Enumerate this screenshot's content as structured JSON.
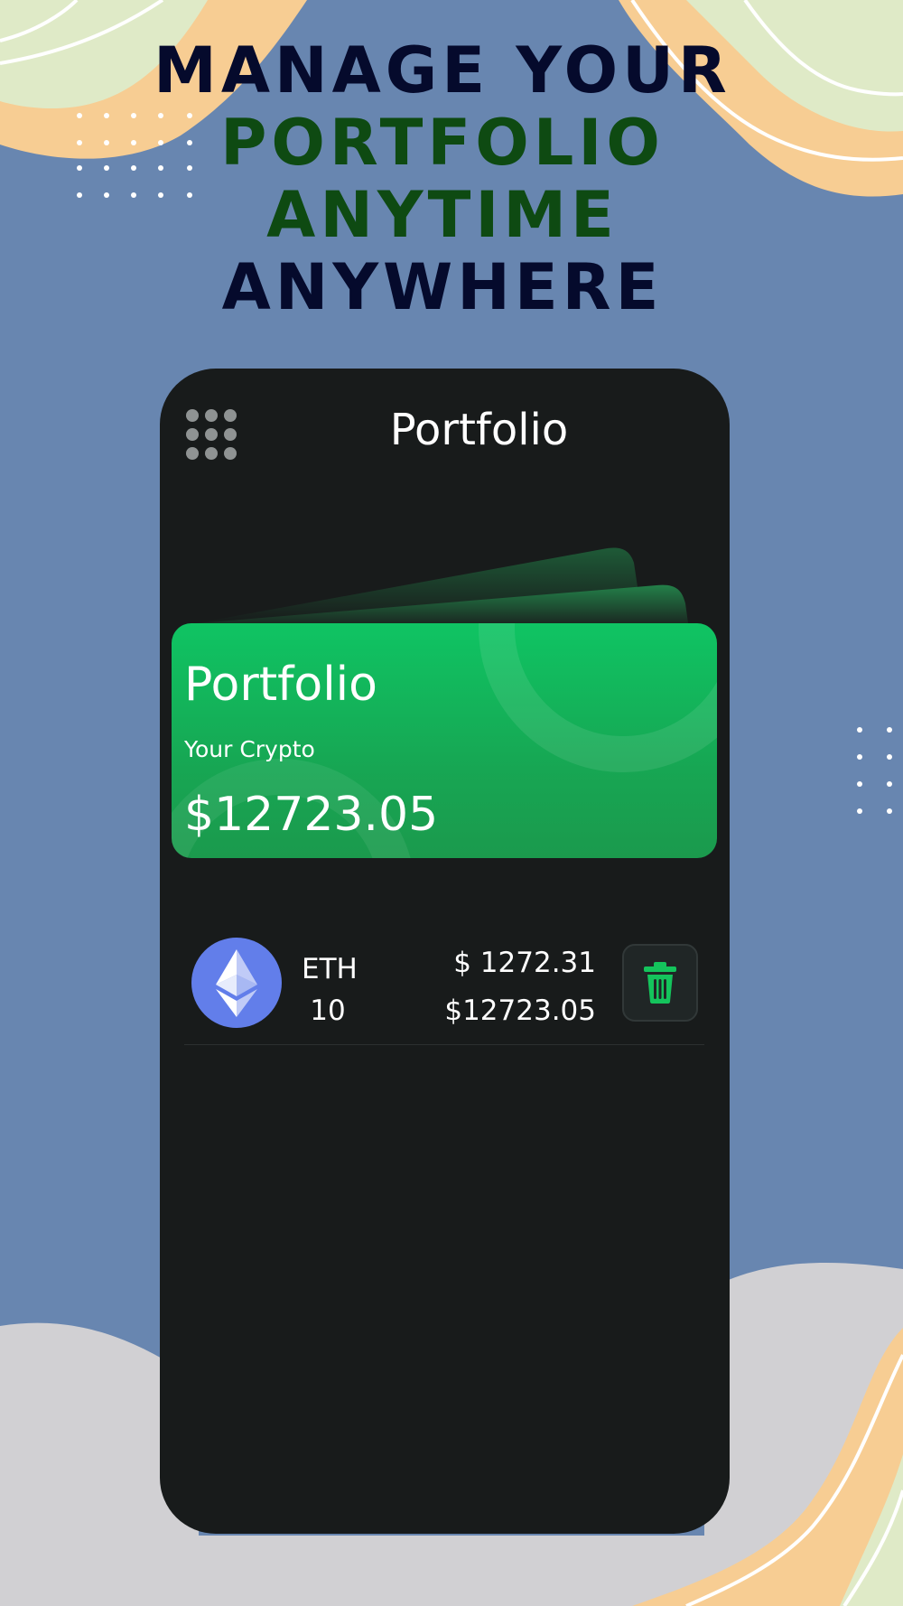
{
  "headline": {
    "line1": "MANAGE YOUR",
    "line2": "PORTFOLIO",
    "line3": "ANYTIME",
    "line4": "ANYWHERE"
  },
  "app": {
    "title": "Portfolio",
    "menu_icon": "grid-dots-icon"
  },
  "card": {
    "title": "Portfolio",
    "subtitle": "Your Crypto",
    "total": "$12723.05"
  },
  "holdings": [
    {
      "icon": "ethereum-icon",
      "symbol": "ETH",
      "quantity": "10",
      "price": "$ 1272.31",
      "value": "$12723.05",
      "delete_icon": "trash-icon"
    }
  ],
  "colors": {
    "background": "#6886b0",
    "headline_dark": "#050a2c",
    "headline_green": "#0e4a12",
    "phone": "#181b1b",
    "card_green": "#0fc463",
    "eth_blue": "#627eea",
    "delete_green": "#14c45c"
  }
}
